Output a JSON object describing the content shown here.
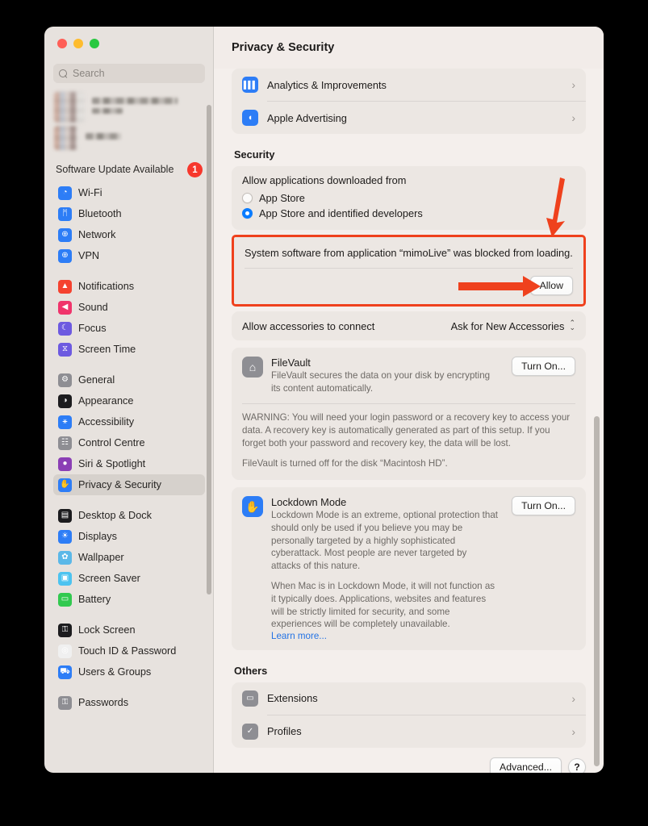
{
  "window": {
    "traffic_lights": [
      "close",
      "minimize",
      "zoom"
    ],
    "colors": {
      "close": "#ff5f57",
      "minimize": "#febc2e",
      "zoom": "#28c840",
      "accent": "#0a7cff",
      "highlight": "#ef411d",
      "badge": "#f7372c",
      "link": "#2272e4"
    }
  },
  "sidebar": {
    "search": {
      "placeholder": "Search",
      "icon": "search-icon"
    },
    "account": {
      "blurred": true
    },
    "software_update": {
      "label": "Software Update Available",
      "badge": "1"
    },
    "groups": [
      {
        "items": [
          {
            "label": "Wi-Fi",
            "icon": "wifi-icon",
            "color": "#2d7df6",
            "glyph": "◔"
          },
          {
            "label": "Bluetooth",
            "icon": "bluetooth-icon",
            "color": "#2d7df6",
            "glyph": "ᛗ"
          },
          {
            "label": "Network",
            "icon": "network-icon",
            "color": "#2d7df6",
            "glyph": "⊕"
          },
          {
            "label": "VPN",
            "icon": "vpn-icon",
            "color": "#2d7df6",
            "glyph": "⊕"
          }
        ]
      },
      {
        "items": [
          {
            "label": "Notifications",
            "icon": "notifications-icon",
            "color": "#f5422f",
            "glyph": "▲"
          },
          {
            "label": "Sound",
            "icon": "sound-icon",
            "color": "#f0346b",
            "glyph": "◀"
          },
          {
            "label": "Focus",
            "icon": "focus-icon",
            "color": "#6d5ae0",
            "glyph": "☾"
          },
          {
            "label": "Screen Time",
            "icon": "screen-time-icon",
            "color": "#6d5ae0",
            "glyph": "⧖"
          }
        ]
      },
      {
        "items": [
          {
            "label": "General",
            "icon": "general-icon",
            "color": "#8e8e93",
            "glyph": "⚙"
          },
          {
            "label": "Appearance",
            "icon": "appearance-icon",
            "color": "#1c1c1e",
            "glyph": "◑"
          },
          {
            "label": "Accessibility",
            "icon": "accessibility-icon",
            "color": "#2d7df6",
            "glyph": "⚹"
          },
          {
            "label": "Control Centre",
            "icon": "control-centre-icon",
            "color": "#8e8e93",
            "glyph": "☷"
          },
          {
            "label": "Siri & Spotlight",
            "icon": "siri-icon",
            "color": "#8b3fb5",
            "glyph": "●"
          },
          {
            "label": "Privacy & Security",
            "icon": "privacy-security-icon",
            "color": "#2d7df6",
            "glyph": "✋",
            "active": true
          }
        ]
      },
      {
        "items": [
          {
            "label": "Desktop & Dock",
            "icon": "desktop-dock-icon",
            "color": "#1c1c1e",
            "glyph": "▤"
          },
          {
            "label": "Displays",
            "icon": "displays-icon",
            "color": "#2d7df6",
            "glyph": "☀"
          },
          {
            "label": "Wallpaper",
            "icon": "wallpaper-icon",
            "color": "#5bb8e8",
            "glyph": "✿"
          },
          {
            "label": "Screen Saver",
            "icon": "screen-saver-icon",
            "color": "#4cc3f0",
            "glyph": "▣"
          },
          {
            "label": "Battery",
            "icon": "battery-icon",
            "color": "#32c94f",
            "glyph": "▭"
          }
        ]
      },
      {
        "items": [
          {
            "label": "Lock Screen",
            "icon": "lock-screen-icon",
            "color": "#1c1c1e",
            "glyph": "⚿"
          },
          {
            "label": "Touch ID & Password",
            "icon": "touch-id-icon",
            "color": "#f0f0f0",
            "glyph": "◎"
          },
          {
            "label": "Users & Groups",
            "icon": "users-groups-icon",
            "color": "#2d7df6",
            "glyph": "⛟"
          }
        ]
      },
      {
        "items": [
          {
            "label": "Passwords",
            "icon": "passwords-icon",
            "color": "#8e8e93",
            "glyph": "⚿"
          }
        ]
      }
    ]
  },
  "main": {
    "title": "Privacy & Security",
    "top_rows": [
      {
        "label": "Analytics & Improvements",
        "icon": "analytics-icon",
        "color": "#2d7df6",
        "glyph": "█",
        "chevron": "›"
      },
      {
        "label": "Apple Advertising",
        "icon": "apple-advertising-icon",
        "color": "#2d7df6",
        "glyph": "◀",
        "chevron": "›"
      }
    ],
    "security": {
      "heading": "Security",
      "allow_apps_label": "Allow applications downloaded from",
      "options": [
        {
          "label": "App Store",
          "selected": false
        },
        {
          "label": "App Store and identified developers",
          "selected": true
        }
      ],
      "blocked": {
        "message": "System software from application “mimoLive” was blocked from loading.",
        "allow_button": "Allow",
        "highlighted": true
      },
      "accessories": {
        "label": "Allow accessories to connect",
        "value": "Ask for New Accessories"
      },
      "filevault": {
        "title": "FileVault",
        "icon": "filevault-icon",
        "description": "FileVault secures the data on your disk by encrypting its content automatically.",
        "button": "Turn On...",
        "warning": "WARNING: You will need your login password or a recovery key to access your data. A recovery key is automatically generated as part of this setup. If you forget both your password and recovery key, the data will be lost.",
        "status": "FileVault is turned off for the disk “Macintosh HD”."
      },
      "lockdown": {
        "title": "Lockdown Mode",
        "icon": "lockdown-mode-icon",
        "description": "Lockdown Mode is an extreme, optional protection that should only be used if you believe you may be personally targeted by a highly sophisticated cyberattack. Most people are never targeted by attacks of this nature.",
        "description2": "When Mac is in Lockdown Mode, it will not function as it typically does. Applications, websites and features will be strictly limited for security, and some experiences will be completely unavailable.",
        "learn_more": "Learn more...",
        "button": "Turn On..."
      }
    },
    "others": {
      "heading": "Others",
      "rows": [
        {
          "label": "Extensions",
          "icon": "extensions-icon",
          "color": "#8e8e93",
          "glyph": "▭",
          "chevron": "›"
        },
        {
          "label": "Profiles",
          "icon": "profiles-icon",
          "color": "#8e8e93",
          "glyph": "✓",
          "chevron": "›"
        }
      ]
    },
    "footer": {
      "advanced": "Advanced...",
      "help": "?"
    }
  },
  "annotations": [
    {
      "type": "arrow-down",
      "target": "allow-section",
      "color": "#ef411d"
    },
    {
      "type": "arrow-right",
      "target": "allow-button",
      "color": "#ef411d"
    },
    {
      "type": "rect",
      "target": "blocked-software-card",
      "color": "#ef411d"
    }
  ]
}
